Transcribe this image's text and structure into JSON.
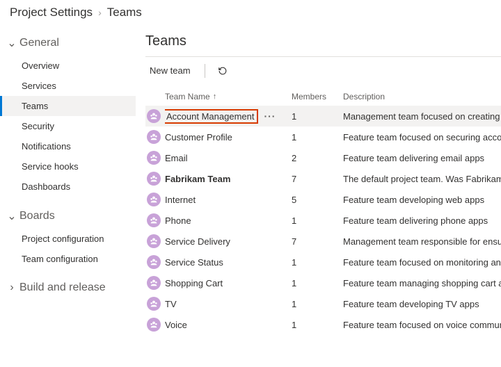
{
  "breadcrumb": {
    "parent": "Project Settings",
    "current": "Teams"
  },
  "sidebar": {
    "groups": [
      {
        "label": "General",
        "expanded": true,
        "items": [
          {
            "label": "Overview",
            "active": false
          },
          {
            "label": "Services",
            "active": false
          },
          {
            "label": "Teams",
            "active": true
          },
          {
            "label": "Security",
            "active": false
          },
          {
            "label": "Notifications",
            "active": false
          },
          {
            "label": "Service hooks",
            "active": false
          },
          {
            "label": "Dashboards",
            "active": false
          }
        ]
      },
      {
        "label": "Boards",
        "expanded": true,
        "items": [
          {
            "label": "Project configuration",
            "active": false
          },
          {
            "label": "Team configuration",
            "active": false
          }
        ]
      },
      {
        "label": "Build and release",
        "expanded": false,
        "items": []
      }
    ]
  },
  "page": {
    "title": "Teams",
    "new_team_label": "New team"
  },
  "table": {
    "columns": {
      "name": "Team Name",
      "members": "Members",
      "description": "Description"
    },
    "sort_asc": true,
    "rows": [
      {
        "name": "Account Management",
        "members": 1,
        "description": "Management team focused on creating an",
        "selected": true,
        "highlighted": true,
        "bold": false
      },
      {
        "name": "Customer Profile",
        "members": 1,
        "description": "Feature team focused on securing account",
        "selected": false,
        "highlighted": false,
        "bold": false
      },
      {
        "name": "Email",
        "members": 2,
        "description": "Feature team delivering email apps",
        "selected": false,
        "highlighted": false,
        "bold": false
      },
      {
        "name": "Fabrikam Team",
        "members": 7,
        "description": "The default project team. Was Fabrikam Fi",
        "selected": false,
        "highlighted": false,
        "bold": true
      },
      {
        "name": "Internet",
        "members": 5,
        "description": "Feature team developing web apps",
        "selected": false,
        "highlighted": false,
        "bold": false
      },
      {
        "name": "Phone",
        "members": 1,
        "description": "Feature team delivering phone apps",
        "selected": false,
        "highlighted": false,
        "bold": false
      },
      {
        "name": "Service Delivery",
        "members": 7,
        "description": "Management team responsible for ensure",
        "selected": false,
        "highlighted": false,
        "bold": false
      },
      {
        "name": "Service Status",
        "members": 1,
        "description": "Feature team focused on monitoring and a",
        "selected": false,
        "highlighted": false,
        "bold": false
      },
      {
        "name": "Shopping Cart",
        "members": 1,
        "description": "Feature team managing shopping cart app",
        "selected": false,
        "highlighted": false,
        "bold": false
      },
      {
        "name": "TV",
        "members": 1,
        "description": "Feature team developing TV apps",
        "selected": false,
        "highlighted": false,
        "bold": false
      },
      {
        "name": "Voice",
        "members": 1,
        "description": "Feature team focused on voice communic",
        "selected": false,
        "highlighted": false,
        "bold": false
      }
    ]
  },
  "icons": {
    "chevron_down": "⌄",
    "chevron_right": "›",
    "sort_up": "↑",
    "more": "···"
  }
}
